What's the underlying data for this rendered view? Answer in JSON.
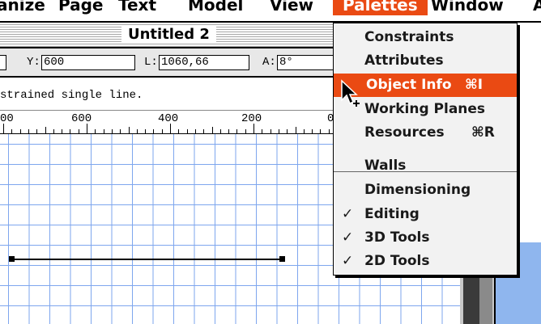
{
  "menubar": {
    "items": [
      "anize",
      "Page",
      "Text",
      "Model",
      "View",
      "Palettes",
      "Window",
      "A"
    ],
    "active_index": 5
  },
  "window": {
    "title": "Untitled 2"
  },
  "databar": {
    "y_label": "Y:",
    "y_value": "600",
    "l_label": "L:",
    "l_value": "1060,66",
    "a_label": "A:",
    "a_value": "8°"
  },
  "message": "strained single line.",
  "ruler": {
    "labels": [
      "00",
      "600",
      "400",
      "200",
      "0"
    ]
  },
  "palettes_menu": {
    "items": [
      {
        "label": "Constraints",
        "checked": false,
        "shortcut": "",
        "highlighted": false
      },
      {
        "label": "Attributes",
        "checked": false,
        "shortcut": "",
        "highlighted": false
      },
      {
        "label": "Object Info",
        "checked": false,
        "shortcut": "⌘I",
        "highlighted": true
      },
      {
        "label": "Working Planes",
        "checked": false,
        "shortcut": "",
        "highlighted": false
      },
      {
        "label": "Resources",
        "checked": false,
        "shortcut": "⌘R",
        "highlighted": false
      },
      {
        "label": "Walls",
        "checked": false,
        "shortcut": "",
        "highlighted": false
      },
      {
        "label": "Dimensioning",
        "checked": false,
        "shortcut": "",
        "highlighted": false
      },
      {
        "label": "Editing",
        "checked": true,
        "shortcut": "",
        "highlighted": false
      },
      {
        "label": "3D Tools",
        "checked": true,
        "shortcut": "",
        "highlighted": false
      },
      {
        "label": "2D Tools",
        "checked": true,
        "shortcut": "",
        "highlighted": false
      }
    ],
    "check_mark": "✓"
  },
  "colors": {
    "highlight": "#ea4a13",
    "grid": "#7ea6ee",
    "desktop": "#8fb6ee"
  },
  "icons": {
    "cursor": "arrow-cursor-icon"
  }
}
